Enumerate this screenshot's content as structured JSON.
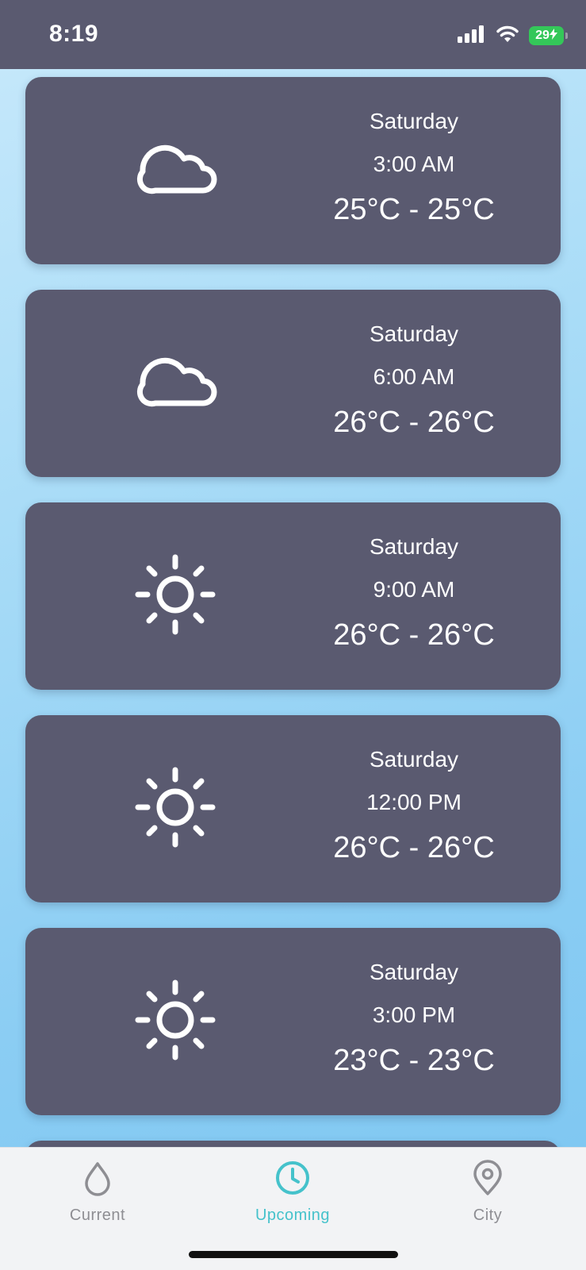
{
  "status_bar": {
    "time": "8:19",
    "battery_level": "29",
    "battery_color": "#34c759",
    "icons": [
      "signal-icon",
      "wifi-icon",
      "battery-icon",
      "charging-icon"
    ]
  },
  "forecast": [
    {
      "day": "Saturday",
      "time": "3:00 AM",
      "temp_range": "25°C - 25°C",
      "icon": "cloud-icon"
    },
    {
      "day": "Saturday",
      "time": "6:00 AM",
      "temp_range": "26°C - 26°C",
      "icon": "cloud-icon"
    },
    {
      "day": "Saturday",
      "time": "9:00 AM",
      "temp_range": "26°C - 26°C",
      "icon": "sun-icon"
    },
    {
      "day": "Saturday",
      "time": "12:00 PM",
      "temp_range": "26°C - 26°C",
      "icon": "sun-icon"
    },
    {
      "day": "Saturday",
      "time": "3:00 PM",
      "temp_range": "23°C - 23°C",
      "icon": "sun-icon"
    }
  ],
  "tab_bar": {
    "active_color": "#45c2cb",
    "inactive_color": "#8e8e93",
    "tabs": [
      {
        "label": "Current",
        "icon": "drop-icon",
        "active": false
      },
      {
        "label": "Upcoming",
        "icon": "clock-icon",
        "active": true
      },
      {
        "label": "City",
        "icon": "location-pin-icon",
        "active": false
      }
    ]
  },
  "colors": {
    "card_background": "#5a5a70",
    "page_background": "#a9dcf7"
  }
}
